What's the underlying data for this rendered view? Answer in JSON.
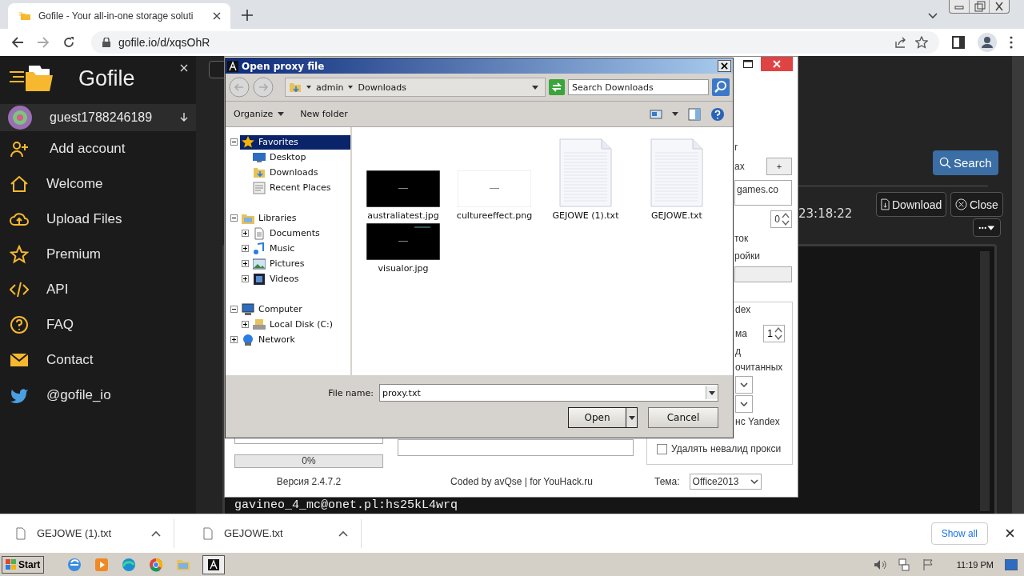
{
  "browser": {
    "tab_title": "Gofile - Your all-in-one storage soluti",
    "url": "gofile.io/d/xqsOhR"
  },
  "sidebar": {
    "brand": "Gofile",
    "user": "guest1788246189",
    "items": [
      {
        "label": "Add account",
        "selected": false
      },
      {
        "label": "Welcome",
        "selected": false
      },
      {
        "label": "Upload Files",
        "selected": false
      },
      {
        "label": "Premium",
        "selected": false
      },
      {
        "label": "API",
        "selected": false
      },
      {
        "label": "FAQ",
        "selected": false
      },
      {
        "label": "Contact",
        "selected": false
      },
      {
        "label": "@gofile_io",
        "selected": false
      }
    ]
  },
  "page": {
    "search_button": "Search",
    "download_button": "Download",
    "close_button": "Close",
    "time": "23:18:22",
    "terminal_line": "gavineo_4_mc@onet.pl:hs25kL4wrq"
  },
  "checker": {
    "right_panel": [
      {
        "kind": "label",
        "text": "r"
      },
      {
        "kind": "label_button",
        "text": "ах",
        "button": "+"
      },
      {
        "kind": "textbox",
        "value": "games.co"
      },
      {
        "kind": "spinner",
        "value": "0"
      },
      {
        "kind": "label",
        "text": "ток"
      },
      {
        "kind": "label",
        "text": "ройки"
      },
      {
        "kind": "button"
      }
    ],
    "group": [
      {
        "kind": "group_title",
        "text": "dex"
      },
      {
        "kind": "label_spinner",
        "text": "ма",
        "value": "1"
      },
      {
        "kind": "label",
        "text": "д"
      },
      {
        "kind": "label",
        "text": "очитанных"
      },
      {
        "kind": "dropdown"
      },
      {
        "kind": "dropdown"
      },
      {
        "kind": "label",
        "text": "нс Yandex"
      },
      {
        "kind": "checkbox",
        "text": "Удалять невалид прокси",
        "checked": false
      }
    ],
    "progress": {
      "level": 0,
      "reading": "0%"
    },
    "version": "Версия 2.4.7.2",
    "credit": "Coded by avQse | for YouHack.ru",
    "theme_label": "Тема:",
    "theme_value": "Office2013"
  },
  "dialog": {
    "title": "Open proxy file",
    "path": [
      "admin",
      "Downloads"
    ],
    "search_placeholder": "Search Downloads",
    "organize": "Organize",
    "new_folder": "New folder",
    "tree": [
      {
        "label": "Favorites",
        "expanded": true,
        "selected": true,
        "children": [
          {
            "label": "Desktop",
            "selected": false
          },
          {
            "label": "Downloads",
            "selected": false
          },
          {
            "label": "Recent Places",
            "selected": false
          }
        ]
      },
      {
        "label": "Libraries",
        "expanded": true,
        "selected": false,
        "children": [
          {
            "label": "Documents",
            "expanded": false,
            "selected": false
          },
          {
            "label": "Music",
            "expanded": false,
            "selected": false
          },
          {
            "label": "Pictures",
            "expanded": false,
            "selected": false
          },
          {
            "label": "Videos",
            "expanded": false,
            "selected": false
          }
        ]
      },
      {
        "label": "Computer",
        "expanded": true,
        "selected": false,
        "children": [
          {
            "label": "Local Disk (C:)",
            "expanded": false,
            "selected": false
          }
        ]
      },
      {
        "label": "Network",
        "expanded": false,
        "selected": false
      }
    ],
    "files": [
      {
        "name": "australiatest.jpg",
        "kind": "picture"
      },
      {
        "name": "cultureeffect.png",
        "kind": "picture"
      },
      {
        "name": "GEJOWE (1).txt",
        "kind": "document"
      },
      {
        "name": "GEJOWE.txt",
        "kind": "document"
      },
      {
        "name": "visualor.jpg",
        "kind": "picture"
      }
    ],
    "file_name_label": "File name:",
    "file_name": "proxy.txt",
    "open_button": "Open",
    "cancel_button": "Cancel"
  },
  "downloads": {
    "items": [
      "GEJOWE (1).txt",
      "GEJOWE.txt"
    ],
    "show_all": "Show all"
  },
  "taskbar": {
    "start": "Start",
    "clock": "11:19 PM"
  }
}
